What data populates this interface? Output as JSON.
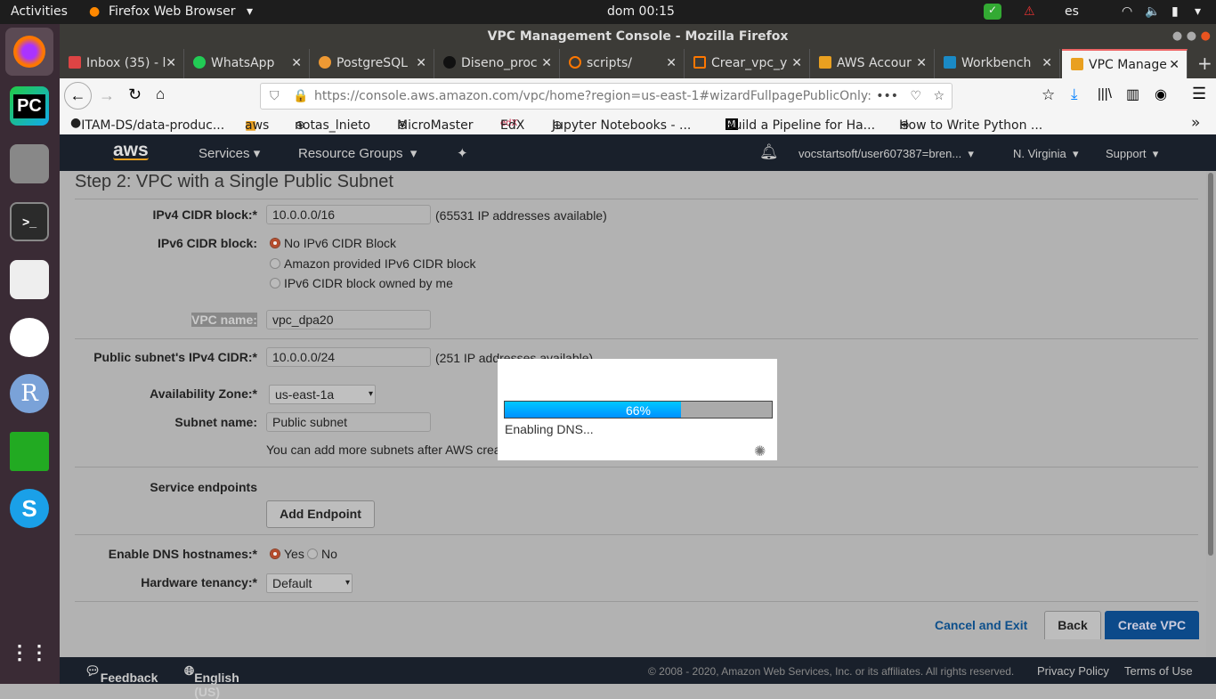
{
  "system": {
    "activities": "Activities",
    "app": "Firefox Web Browser",
    "clock": "dom 00:15",
    "lang": "es"
  },
  "dock": [
    {
      "name": "firefox"
    },
    {
      "name": "pycharm",
      "label": "PC"
    },
    {
      "name": "files"
    },
    {
      "name": "terminal",
      "label": ">_"
    },
    {
      "name": "text-editor"
    },
    {
      "name": "slack"
    },
    {
      "name": "r",
      "label": "R"
    },
    {
      "name": "spreadsheet"
    },
    {
      "name": "skype",
      "label": "S"
    }
  ],
  "window": {
    "title": "VPC Management Console - Mozilla Firefox"
  },
  "tabs": [
    {
      "label": "Inbox (35) - l",
      "color": "#d44"
    },
    {
      "label": "WhatsApp",
      "color": "#2c5"
    },
    {
      "label": "PostgreSQL",
      "color": "#e93"
    },
    {
      "label": "Diseno_proc",
      "color": "#222"
    },
    {
      "label": "scripts/",
      "color": "#f70"
    },
    {
      "label": "Crear_vpc_y",
      "color": "#f70"
    },
    {
      "label": "AWS Accour",
      "color": "#e9a020"
    },
    {
      "label": "Workbench",
      "color": "#1a8ac6"
    },
    {
      "label": "VPC Manage",
      "color": "#e9a020",
      "active": true
    }
  ],
  "address": {
    "url": "https://console.aws.amazon.com/vpc/home?region=us-east-1#wizardFullpagePublicOnly:"
  },
  "bookmarks": [
    "ITAM-DS/data-produc...",
    "aws",
    "notas_lnieto",
    "MicroMaster",
    "EdX",
    "Jupyter Notebooks - ...",
    "Build a Pipeline for Ha...",
    "How to Write Python ..."
  ],
  "aws": {
    "logo": "aws",
    "services": "Services",
    "resource_groups": "Resource Groups",
    "account": "vocstartsoft/user607387=bren...",
    "region": "N. Virginia",
    "support": "Support"
  },
  "form": {
    "title": "Step 2: VPC with a Single Public Subnet",
    "ipv4_label": "IPv4 CIDR block:*",
    "ipv4_value": "10.0.0.0/16",
    "ipv4_note": "(65531 IP addresses available)",
    "ipv6_label": "IPv6 CIDR block:",
    "ipv6_options": [
      "No IPv6 CIDR Block",
      "Amazon provided IPv6 CIDR block",
      "IPv6 CIDR block owned by me"
    ],
    "vpc_name_label": "VPC name:",
    "vpc_name_value": "vpc_dpa20",
    "subnet_cidr_label": "Public subnet's IPv4 CIDR:*",
    "subnet_cidr_value": "10.0.0.0/24",
    "subnet_cidr_note": "(251 IP addresses available)",
    "az_label": "Availability Zone:*",
    "az_value": "us-east-1a",
    "subnet_name_label": "Subnet name:",
    "subnet_name_value": "Public subnet",
    "subnet_hint": "You can add more subnets after AWS creates the VPC.",
    "endpoints_label": "Service endpoints",
    "add_endpoint": "Add Endpoint",
    "dns_label": "Enable DNS hostnames:*",
    "dns_yes": "Yes",
    "dns_no": "No",
    "tenancy_label": "Hardware tenancy:*",
    "tenancy_value": "Default",
    "cancel": "Cancel and Exit",
    "back": "Back",
    "create": "Create VPC"
  },
  "progress": {
    "percent": 66,
    "percent_label": "66%",
    "status": "Enabling DNS..."
  },
  "footer": {
    "feedback": "Feedback",
    "language": "English (US)",
    "copyright": "© 2008 - 2020, Amazon Web Services, Inc. or its affiliates. All rights reserved.",
    "privacy": "Privacy Policy",
    "terms": "Terms of Use"
  }
}
